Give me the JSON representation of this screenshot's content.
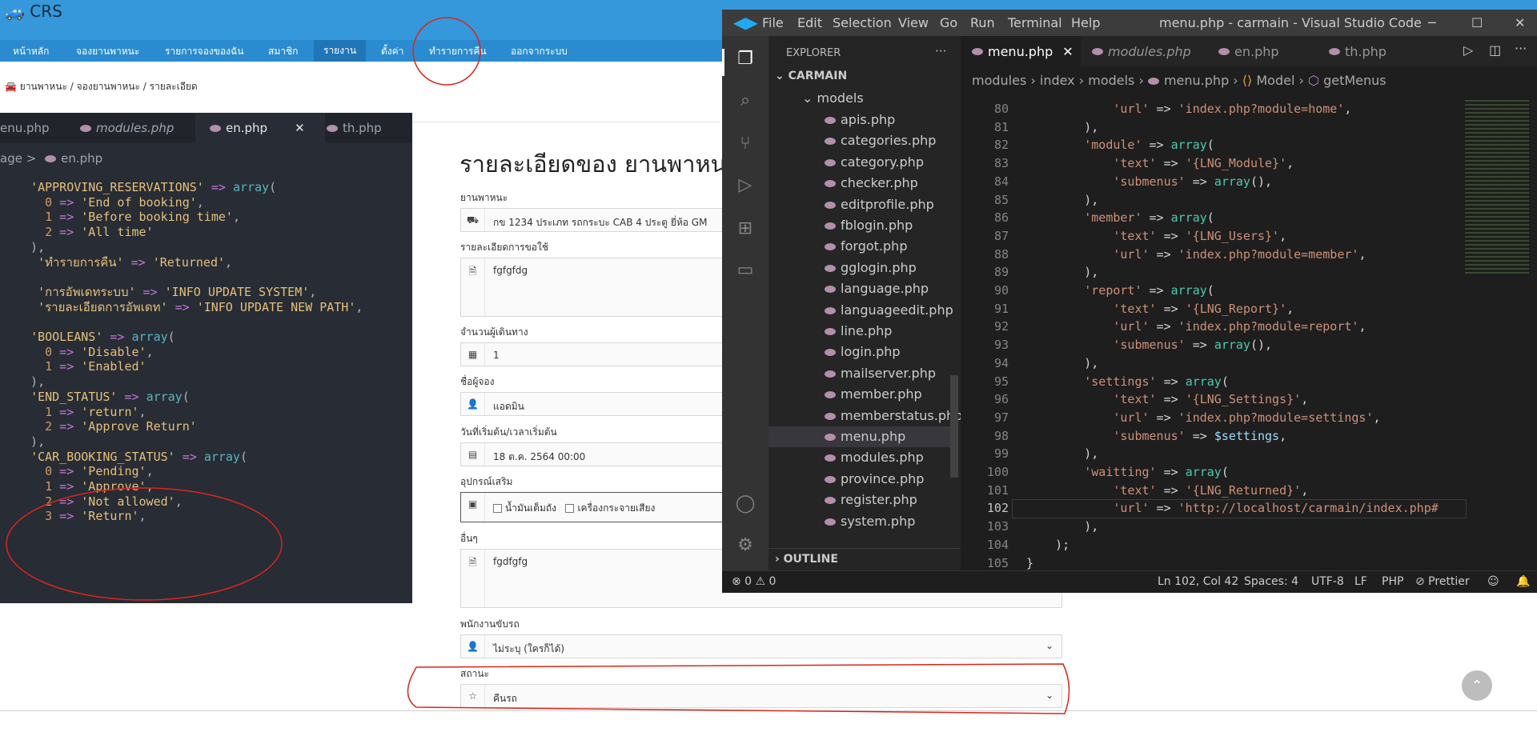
{
  "app": {
    "brand": "CRS",
    "nav": [
      "หน้าหลัก",
      "จองยานพาหนะ",
      "รายการจองของฉัน",
      "สมาชิก",
      "รายงาน",
      "ตั้งค่า",
      "ทำรายการคืน",
      "ออกจากระบบ"
    ],
    "breadcrumb": "ยานพาหนะ / จองยานพาหนะ / รายละเอียด",
    "page_title": "รายละเอียดของ ยานพาหน",
    "fields": {
      "vehicle_label": "ยานพาหนะ",
      "vehicle_value": "กข 1234 ประเภท รถกระบะ CAB 4 ประตู ยี่ห้อ GM",
      "detail_label": "รายละเอียดการขอใช้",
      "detail_value": "fgfgfdg",
      "passengers_label": "จำนวนผู้เดินทาง",
      "passengers_value": "1",
      "booker_label": "ชื่อผู้จอง",
      "booker_value": "แอดมิน",
      "start_label": "วันที่เริ่มต้น/เวลาเริ่มต้น",
      "start_value": "18 ต.ค. 2564 00:00",
      "accessories_label": "อุปกรณ์เสริม",
      "accessory_1": "น้ำมันเต็มถัง",
      "accessory_2": "เครื่องกระจายเสียง",
      "other_label": "อื่นๆ",
      "other_value": "fgdfgfg",
      "driver_label": "พนักงานขับรถ",
      "driver_value": "ไม่ระบุ (ใครก็ได้)",
      "status_label": "สถานะ",
      "status_value": "คืนรถ"
    }
  },
  "left_editor": {
    "tabs": [
      "enu.php",
      "modules.php",
      "en.php",
      "th.php"
    ],
    "close_glyph": "✕",
    "breadcrumb_1": "age",
    "breadcrumb_sep": ">",
    "breadcrumb_2": "en.php",
    "lines": [
      [
        [
          "pl",
          "  "
        ],
        [
          "s",
          "'APPROVING_RESERVATIONS'"
        ],
        [
          "op",
          " => "
        ],
        [
          "fn",
          "array"
        ],
        [
          "pl",
          "("
        ]
      ],
      [
        [
          "pl",
          "    "
        ],
        [
          "num",
          "0"
        ],
        [
          "op",
          " => "
        ],
        [
          "s",
          "'End of booking'"
        ],
        [
          "pl",
          ","
        ]
      ],
      [
        [
          "pl",
          "    "
        ],
        [
          "num",
          "1"
        ],
        [
          "op",
          " => "
        ],
        [
          "s",
          "'Before booking time'"
        ],
        [
          "pl",
          ","
        ]
      ],
      [
        [
          "pl",
          "    "
        ],
        [
          "num",
          "2"
        ],
        [
          "op",
          " => "
        ],
        [
          "s",
          "'All time'"
        ]
      ],
      [
        [
          "pl",
          "  ),"
        ]
      ],
      [
        [
          "pl",
          "   "
        ],
        [
          "s",
          "'ทำรายการคืน'"
        ],
        [
          "op",
          " => "
        ],
        [
          "s",
          "'Returned'"
        ],
        [
          "pl",
          ","
        ]
      ],
      [
        [
          "pl",
          ""
        ]
      ],
      [
        [
          "pl",
          "   "
        ],
        [
          "s",
          "'การอัพเดทระบบ'"
        ],
        [
          "op",
          " => "
        ],
        [
          "s",
          "'INFO UPDATE SYSTEM'"
        ],
        [
          "pl",
          ","
        ]
      ],
      [
        [
          "pl",
          "   "
        ],
        [
          "s",
          "'รายละเอียดการอัพเดท'"
        ],
        [
          "op",
          " => "
        ],
        [
          "s",
          "'INFO UPDATE NEW PATH'"
        ],
        [
          "pl",
          ","
        ]
      ],
      [
        [
          "pl",
          ""
        ]
      ],
      [
        [
          "pl",
          "  "
        ],
        [
          "s",
          "'BOOLEANS'"
        ],
        [
          "op",
          " => "
        ],
        [
          "fn",
          "array"
        ],
        [
          "pl",
          "("
        ]
      ],
      [
        [
          "pl",
          "    "
        ],
        [
          "num",
          "0"
        ],
        [
          "op",
          " => "
        ],
        [
          "s",
          "'Disable'"
        ],
        [
          "pl",
          ","
        ]
      ],
      [
        [
          "pl",
          "    "
        ],
        [
          "num",
          "1"
        ],
        [
          "op",
          " => "
        ],
        [
          "s",
          "'Enabled'"
        ]
      ],
      [
        [
          "pl",
          "  ),"
        ]
      ],
      [
        [
          "pl",
          "  "
        ],
        [
          "s",
          "'END_STATUS'"
        ],
        [
          "op",
          " => "
        ],
        [
          "fn",
          "array"
        ],
        [
          "pl",
          "("
        ]
      ],
      [
        [
          "pl",
          "    "
        ],
        [
          "num",
          "1"
        ],
        [
          "op",
          " => "
        ],
        [
          "s",
          "'return'"
        ],
        [
          "pl",
          ","
        ]
      ],
      [
        [
          "pl",
          "    "
        ],
        [
          "num",
          "2"
        ],
        [
          "op",
          " => "
        ],
        [
          "s",
          "'Approve Return'"
        ]
      ],
      [
        [
          "pl",
          "  ),"
        ]
      ],
      [
        [
          "pl",
          "  "
        ],
        [
          "s",
          "'CAR_BOOKING_STATUS'"
        ],
        [
          "op",
          " => "
        ],
        [
          "fn",
          "array"
        ],
        [
          "pl",
          "("
        ]
      ],
      [
        [
          "pl",
          "    "
        ],
        [
          "num",
          "0"
        ],
        [
          "op",
          " => "
        ],
        [
          "s",
          "'Pending'"
        ],
        [
          "pl",
          ","
        ]
      ],
      [
        [
          "pl",
          "    "
        ],
        [
          "num",
          "1"
        ],
        [
          "op",
          " => "
        ],
        [
          "s",
          "'Approve'"
        ],
        [
          "pl",
          ","
        ]
      ],
      [
        [
          "pl",
          "    "
        ],
        [
          "num",
          "2"
        ],
        [
          "op",
          " => "
        ],
        [
          "s",
          "'Not allowed'"
        ],
        [
          "pl",
          ","
        ]
      ],
      [
        [
          "pl",
          "    "
        ],
        [
          "num",
          "3"
        ],
        [
          "op",
          " => "
        ],
        [
          "s",
          "'Return'"
        ],
        [
          "pl",
          ","
        ]
      ]
    ]
  },
  "vscode": {
    "menu": [
      "File",
      "Edit",
      "Selection",
      "View",
      "Go",
      "Run",
      "Terminal",
      "Help"
    ],
    "window_title": "menu.php - carmain - Visual Studio Code",
    "window_controls": [
      "─",
      "☐",
      "✕"
    ],
    "explorer_title": "EXPLORER",
    "explorer_more": "···",
    "folder": "CARMAIN",
    "subfolder": "models",
    "files": [
      "apis.php",
      "categories.php",
      "category.php",
      "checker.php",
      "editprofile.php",
      "fblogin.php",
      "forgot.php",
      "gglogin.php",
      "language.php",
      "languageedit.php",
      "line.php",
      "login.php",
      "mailserver.php",
      "member.php",
      "memberstatus.php",
      "menu.php",
      "modules.php",
      "province.php",
      "register.php",
      "system.php"
    ],
    "selected_file": "menu.php",
    "outline": "OUTLINE",
    "tabs": [
      "menu.php",
      "modules.php",
      "en.php",
      "th.php"
    ],
    "active_tab": "menu.php",
    "breadcrumb": [
      "modules",
      "index",
      "models",
      "menu.php",
      "Model",
      "getMenus"
    ],
    "code_lines": [
      {
        "n": "80",
        "t": [
          [
            "p",
            "            "
          ],
          [
            "s",
            "'url'"
          ],
          [
            "p",
            " => "
          ],
          [
            "s",
            "'index.php?module=home'"
          ],
          [
            "p",
            ","
          ]
        ]
      },
      {
        "n": "81",
        "t": [
          [
            "p",
            "        ),"
          ]
        ]
      },
      {
        "n": "82",
        "t": [
          [
            "p",
            "        "
          ],
          [
            "s",
            "'module'"
          ],
          [
            "p",
            " => "
          ],
          [
            "k",
            "array"
          ],
          [
            "p",
            "("
          ]
        ]
      },
      {
        "n": "83",
        "t": [
          [
            "p",
            "            "
          ],
          [
            "s",
            "'text'"
          ],
          [
            "p",
            " => "
          ],
          [
            "s",
            "'{LNG_Module}'"
          ],
          [
            "p",
            ","
          ]
        ]
      },
      {
        "n": "84",
        "t": [
          [
            "p",
            "            "
          ],
          [
            "s",
            "'submenus'"
          ],
          [
            "p",
            " => "
          ],
          [
            "k",
            "array"
          ],
          [
            "p",
            "(),"
          ]
        ]
      },
      {
        "n": "85",
        "t": [
          [
            "p",
            "        ),"
          ]
        ]
      },
      {
        "n": "86",
        "t": [
          [
            "p",
            "        "
          ],
          [
            "s",
            "'member'"
          ],
          [
            "p",
            " => "
          ],
          [
            "k",
            "array"
          ],
          [
            "p",
            "("
          ]
        ]
      },
      {
        "n": "87",
        "t": [
          [
            "p",
            "            "
          ],
          [
            "s",
            "'text'"
          ],
          [
            "p",
            " => "
          ],
          [
            "s",
            "'{LNG_Users}'"
          ],
          [
            "p",
            ","
          ]
        ]
      },
      {
        "n": "88",
        "t": [
          [
            "p",
            "            "
          ],
          [
            "s",
            "'url'"
          ],
          [
            "p",
            " => "
          ],
          [
            "s",
            "'index.php?module=member'"
          ],
          [
            "p",
            ","
          ]
        ]
      },
      {
        "n": "89",
        "t": [
          [
            "p",
            "        ),"
          ]
        ]
      },
      {
        "n": "90",
        "t": [
          [
            "p",
            "        "
          ],
          [
            "s",
            "'report'"
          ],
          [
            "p",
            " => "
          ],
          [
            "k",
            "array"
          ],
          [
            "p",
            "("
          ]
        ]
      },
      {
        "n": "91",
        "t": [
          [
            "p",
            "            "
          ],
          [
            "s",
            "'text'"
          ],
          [
            "p",
            " => "
          ],
          [
            "s",
            "'{LNG_Report}'"
          ],
          [
            "p",
            ","
          ]
        ]
      },
      {
        "n": "92",
        "t": [
          [
            "p",
            "            "
          ],
          [
            "s",
            "'url'"
          ],
          [
            "p",
            " => "
          ],
          [
            "s",
            "'index.php?module=report'"
          ],
          [
            "p",
            ","
          ]
        ]
      },
      {
        "n": "93",
        "t": [
          [
            "p",
            "            "
          ],
          [
            "s",
            "'submenus'"
          ],
          [
            "p",
            " => "
          ],
          [
            "k",
            "array"
          ],
          [
            "p",
            "(),"
          ]
        ]
      },
      {
        "n": "94",
        "t": [
          [
            "p",
            "        ),"
          ]
        ]
      },
      {
        "n": "95",
        "t": [
          [
            "p",
            "        "
          ],
          [
            "s",
            "'settings'"
          ],
          [
            "p",
            " => "
          ],
          [
            "k",
            "array"
          ],
          [
            "p",
            "("
          ]
        ]
      },
      {
        "n": "96",
        "t": [
          [
            "p",
            "            "
          ],
          [
            "s",
            "'text'"
          ],
          [
            "p",
            " => "
          ],
          [
            "s",
            "'{LNG_Settings}'"
          ],
          [
            "p",
            ","
          ]
        ]
      },
      {
        "n": "97",
        "t": [
          [
            "p",
            "            "
          ],
          [
            "s",
            "'url'"
          ],
          [
            "p",
            " => "
          ],
          [
            "s",
            "'index.php?module=settings'"
          ],
          [
            "p",
            ","
          ]
        ]
      },
      {
        "n": "98",
        "t": [
          [
            "p",
            "            "
          ],
          [
            "s",
            "'submenus'"
          ],
          [
            "p",
            " => "
          ],
          [
            "v",
            "$settings"
          ],
          [
            "p",
            ","
          ]
        ]
      },
      {
        "n": "99",
        "t": [
          [
            "p",
            "        ),"
          ]
        ]
      },
      {
        "n": "100",
        "t": [
          [
            "p",
            "        "
          ],
          [
            "s",
            "'waitting'"
          ],
          [
            "p",
            " => "
          ],
          [
            "k",
            "array"
          ],
          [
            "p",
            "("
          ]
        ]
      },
      {
        "n": "101",
        "t": [
          [
            "p",
            "            "
          ],
          [
            "s",
            "'text'"
          ],
          [
            "p",
            " => "
          ],
          [
            "s",
            "'{LNG_Returned}'"
          ],
          [
            "p",
            ","
          ]
        ]
      },
      {
        "n": "102",
        "t": [
          [
            "p",
            "            "
          ],
          [
            "s",
            "'url'"
          ],
          [
            "p",
            " => "
          ],
          [
            "s",
            "'http://localhost/carmain/index.php#"
          ]
        ]
      },
      {
        "n": "103",
        "t": [
          [
            "p",
            "        ),"
          ]
        ]
      },
      {
        "n": "104",
        "t": [
          [
            "p",
            "    );"
          ]
        ]
      },
      {
        "n": "105",
        "t": [
          [
            "p",
            "}"
          ]
        ]
      }
    ],
    "status": {
      "errors": "⊗ 0 ⚠ 0",
      "position": "Ln 102, Col 42",
      "spaces": "Spaces: 4",
      "encoding": "UTF-8",
      "eol": "LF",
      "language": "PHP",
      "formatter": "⊘ Prettier"
    },
    "colors": {
      "string": "#ce9178",
      "keyword": "#4ec9b0",
      "variable": "#9cdcfe",
      "plain": "#d4d4d4"
    }
  }
}
